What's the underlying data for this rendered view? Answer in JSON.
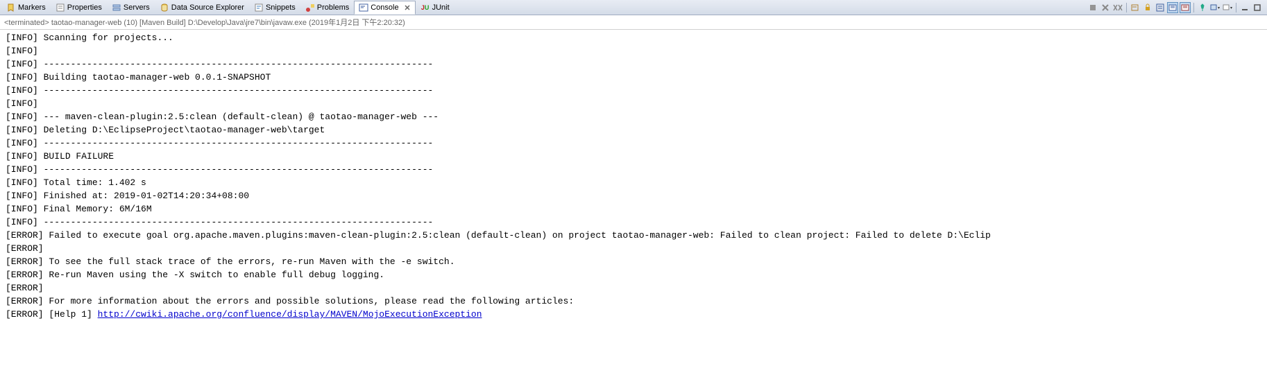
{
  "tabs": [
    {
      "label": "Markers",
      "icon": "markers"
    },
    {
      "label": "Properties",
      "icon": "properties"
    },
    {
      "label": "Servers",
      "icon": "servers"
    },
    {
      "label": "Data Source Explorer",
      "icon": "datasource"
    },
    {
      "label": "Snippets",
      "icon": "snippets"
    },
    {
      "label": "Problems",
      "icon": "problems"
    },
    {
      "label": "Console",
      "icon": "console",
      "active": true,
      "closable": true
    },
    {
      "label": "JUnit",
      "icon": "junit"
    }
  ],
  "status": "<terminated> taotao-manager-web (10) [Maven Build] D:\\Develop\\Java\\jre7\\bin\\javaw.exe (2019年1月2日 下午2:20:32)",
  "lines": [
    {
      "tag": "[INFO]",
      "text": " Scanning for projects..."
    },
    {
      "tag": "[INFO]",
      "text": ""
    },
    {
      "tag": "[INFO]",
      "text": " ------------------------------------------------------------------------"
    },
    {
      "tag": "[INFO]",
      "text": " Building taotao-manager-web 0.0.1-SNAPSHOT"
    },
    {
      "tag": "[INFO]",
      "text": " ------------------------------------------------------------------------"
    },
    {
      "tag": "[INFO]",
      "text": ""
    },
    {
      "tag": "[INFO]",
      "text": " --- maven-clean-plugin:2.5:clean (default-clean) @ taotao-manager-web ---"
    },
    {
      "tag": "[INFO]",
      "text": " Deleting D:\\EclipseProject\\taotao-manager-web\\target"
    },
    {
      "tag": "[INFO]",
      "text": " ------------------------------------------------------------------------"
    },
    {
      "tag": "[INFO]",
      "text": " BUILD FAILURE"
    },
    {
      "tag": "[INFO]",
      "text": " ------------------------------------------------------------------------"
    },
    {
      "tag": "[INFO]",
      "text": " Total time: 1.402 s"
    },
    {
      "tag": "[INFO]",
      "text": " Finished at: 2019-01-02T14:20:34+08:00"
    },
    {
      "tag": "[INFO]",
      "text": " Final Memory: 6M/16M"
    },
    {
      "tag": "[INFO]",
      "text": " ------------------------------------------------------------------------"
    },
    {
      "tag": "[ERROR]",
      "text": " Failed to execute goal org.apache.maven.plugins:maven-clean-plugin:2.5:clean (default-clean) on project taotao-manager-web: Failed to clean project: Failed to delete D:\\Eclip"
    },
    {
      "tag": "[ERROR]",
      "text": ""
    },
    {
      "tag": "[ERROR]",
      "text": " To see the full stack trace of the errors, re-run Maven with the -e switch."
    },
    {
      "tag": "[ERROR]",
      "text": " Re-run Maven using the -X switch to enable full debug logging."
    },
    {
      "tag": "[ERROR]",
      "text": ""
    },
    {
      "tag": "[ERROR]",
      "text": " For more information about the errors and possible solutions, please read the following articles:"
    },
    {
      "tag": "[ERROR]",
      "text": " [Help 1] ",
      "link": "http://cwiki.apache.org/confluence/display/MAVEN/MojoExecutionException"
    }
  ]
}
